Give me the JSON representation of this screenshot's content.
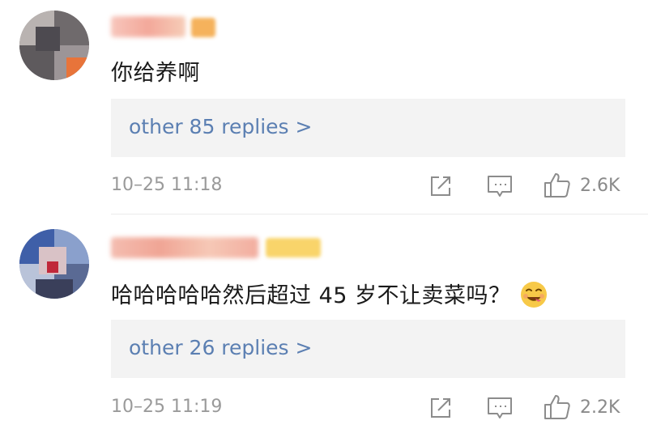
{
  "comments": [
    {
      "text": "你给养啊",
      "replies_link": "other 85 replies >",
      "timestamp": "10–25 11:18",
      "like_count": "2.6K",
      "icons": [
        "share-icon",
        "comment-icon",
        "like-icon"
      ]
    },
    {
      "text": "哈哈哈哈哈然后超过 45 岁不让卖菜吗？",
      "emoji": "yum-face-emoji",
      "replies_link": "other 26 replies >",
      "timestamp": "10–25 11:19",
      "like_count": "2.2K",
      "icons": [
        "share-icon",
        "comment-icon",
        "like-icon"
      ]
    }
  ],
  "colors": {
    "link": "#5b7fb2",
    "meta": "#9a9a9a",
    "reply_box_bg": "#f3f3f3",
    "text": "#1a1a1a"
  }
}
